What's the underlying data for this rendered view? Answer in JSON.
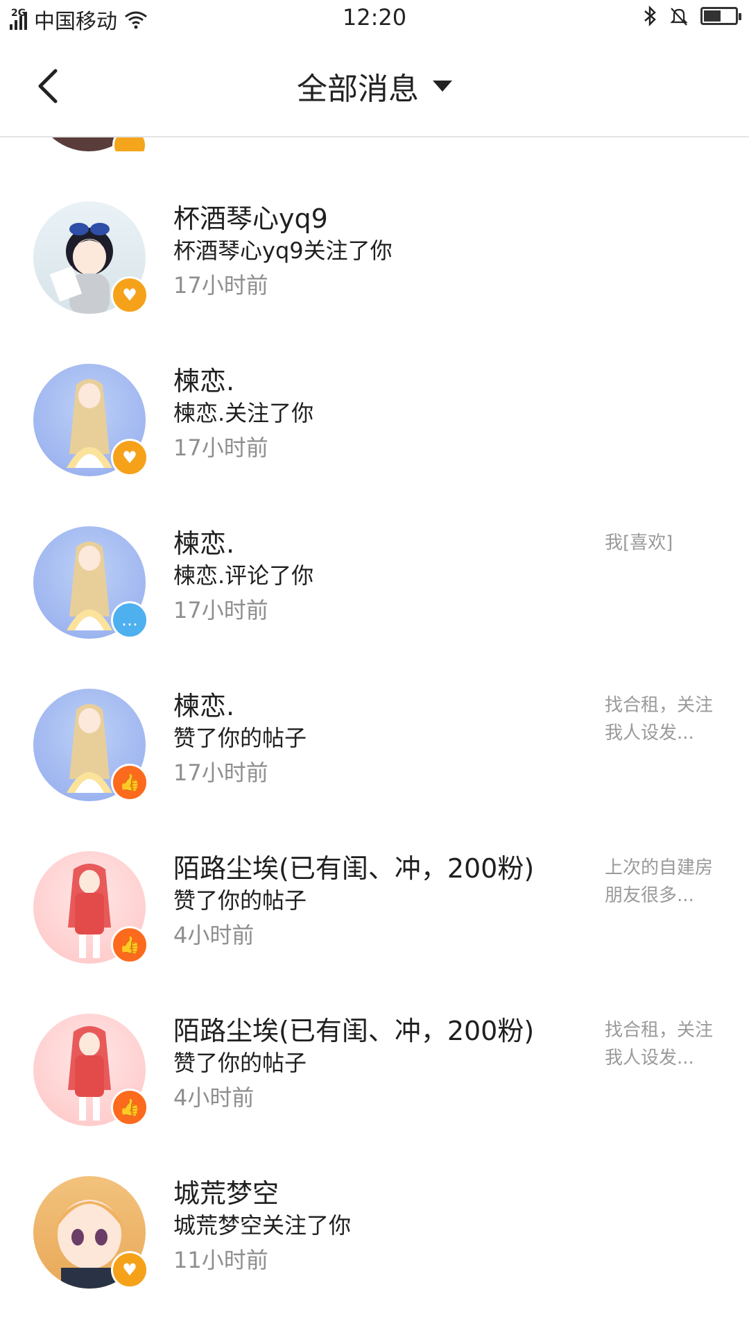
{
  "status_bar": {
    "network": "2G",
    "carrier": "中国移动",
    "time": "12:20"
  },
  "header": {
    "title": "全部消息"
  },
  "items": [
    {
      "name": "杯酒琴心yq9",
      "action": "杯酒琴心yq9关注了你",
      "time": "17小时前",
      "badge": "follow",
      "avatar": "girl-dark-hair",
      "excerpt": ""
    },
    {
      "name": "楝恋.",
      "action": "楝恋.关注了你",
      "time": "17小时前",
      "badge": "follow",
      "avatar": "girl-blonde-dress",
      "excerpt": ""
    },
    {
      "name": "楝恋.",
      "action": "楝恋.评论了你",
      "time": "17小时前",
      "badge": "comment",
      "avatar": "girl-blonde-dress",
      "excerpt": "我[喜欢]"
    },
    {
      "name": "楝恋.",
      "action": "赞了你的帖子",
      "time": "17小时前",
      "badge": "like",
      "avatar": "girl-blonde-dress",
      "excerpt": "找合租，关注我人设发..."
    },
    {
      "name": "陌路尘埃(已有闺、冲，200粉)",
      "action": "赞了你的帖子",
      "time": "4小时前",
      "badge": "like",
      "avatar": "girl-red-hair",
      "excerpt": "上次的自建房朋友很多..."
    },
    {
      "name": "陌路尘埃(已有闺、冲，200粉)",
      "action": "赞了你的帖子",
      "time": "4小时前",
      "badge": "like",
      "avatar": "girl-red-hair",
      "excerpt": "找合租，关注我人设发..."
    },
    {
      "name": "城荒梦空",
      "action": "城荒梦空关注了你",
      "time": "11小时前",
      "badge": "follow",
      "avatar": "girl-blonde-anime",
      "excerpt": ""
    }
  ]
}
